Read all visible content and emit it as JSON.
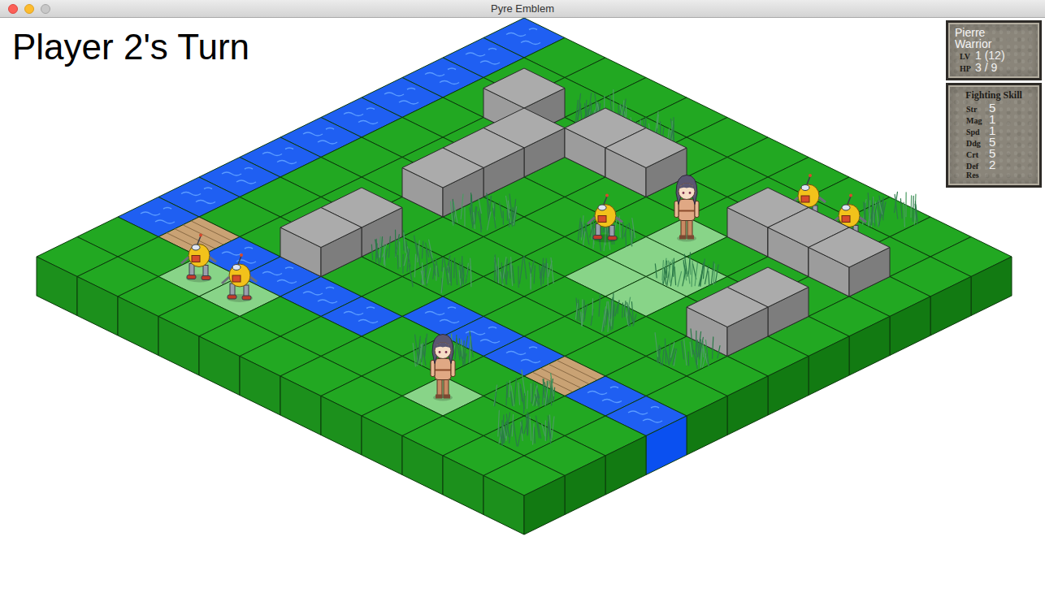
{
  "window": {
    "title": "Pyre Emblem"
  },
  "turn_banner": "Player 2's Turn",
  "unit_panel": {
    "name": "Pierre",
    "class": "Warrior",
    "level_label": "LV",
    "level": "1 (12)",
    "hp_label": "HP",
    "hp": "3 / 9"
  },
  "skills_panel": {
    "title": "Fighting Skill",
    "stats": [
      {
        "label": "Str",
        "value": "5"
      },
      {
        "label": "Mag",
        "value": "1"
      },
      {
        "label": "Spd",
        "value": "1"
      },
      {
        "label": "Ddg",
        "value": "5"
      },
      {
        "label": "Crt",
        "value": "5"
      },
      {
        "label": "Def",
        "value": "2"
      },
      {
        "label": "Res"
      }
    ]
  },
  "board": {
    "water": [
      [
        0,
        0
      ],
      [
        0,
        1
      ],
      [
        0,
        2
      ],
      [
        0,
        3
      ],
      [
        0,
        4
      ],
      [
        0,
        5
      ],
      [
        0,
        6
      ],
      [
        0,
        7
      ],
      [
        0,
        8
      ],
      [
        0,
        9
      ],
      [
        2,
        9
      ],
      [
        3,
        9
      ],
      [
        4,
        9
      ],
      [
        5,
        9
      ],
      [
        6,
        8
      ],
      [
        7,
        8
      ],
      [
        8,
        8
      ],
      [
        10,
        8
      ],
      [
        11,
        8
      ]
    ],
    "bridges": [
      [
        1,
        9
      ],
      [
        9,
        8
      ]
    ],
    "highlighted": [
      [
        2,
        10
      ],
      [
        3,
        10
      ],
      [
        7,
        3
      ],
      [
        7,
        4
      ],
      [
        7,
        5
      ],
      [
        8,
        5
      ],
      [
        8,
        4
      ],
      [
        8,
        10
      ]
    ],
    "blocks": [
      [
        2,
        2
      ],
      [
        3,
        3
      ],
      [
        3,
        4
      ],
      [
        3,
        5
      ],
      [
        4,
        2
      ],
      [
        5,
        2
      ],
      [
        3,
        7
      ],
      [
        3,
        8
      ],
      [
        8,
        2
      ],
      [
        9,
        2
      ],
      [
        10,
        2
      ],
      [
        10,
        4
      ],
      [
        10,
        5
      ]
    ],
    "grass": [
      [
        3,
        1
      ],
      [
        4,
        1
      ],
      [
        4,
        5
      ],
      [
        4,
        7
      ],
      [
        5,
        7
      ],
      [
        6,
        6
      ],
      [
        8,
        4
      ],
      [
        8,
        6
      ],
      [
        6,
        4
      ],
      [
        9,
        0
      ],
      [
        7,
        9
      ],
      [
        9,
        9
      ],
      [
        10,
        10
      ],
      [
        10,
        6
      ]
    ],
    "units": [
      {
        "kind": "robot",
        "at": [
          2,
          10
        ]
      },
      {
        "kind": "robot",
        "at": [
          3,
          10
        ]
      },
      {
        "kind": "robot",
        "at": [
          6,
          4
        ]
      },
      {
        "kind": "warrior",
        "at": [
          7,
          3
        ]
      },
      {
        "kind": "robot",
        "at": [
          8,
          1
        ]
      },
      {
        "kind": "robot",
        "at": [
          9,
          1
        ]
      },
      {
        "kind": "warrior",
        "at": [
          8,
          10
        ]
      }
    ]
  }
}
